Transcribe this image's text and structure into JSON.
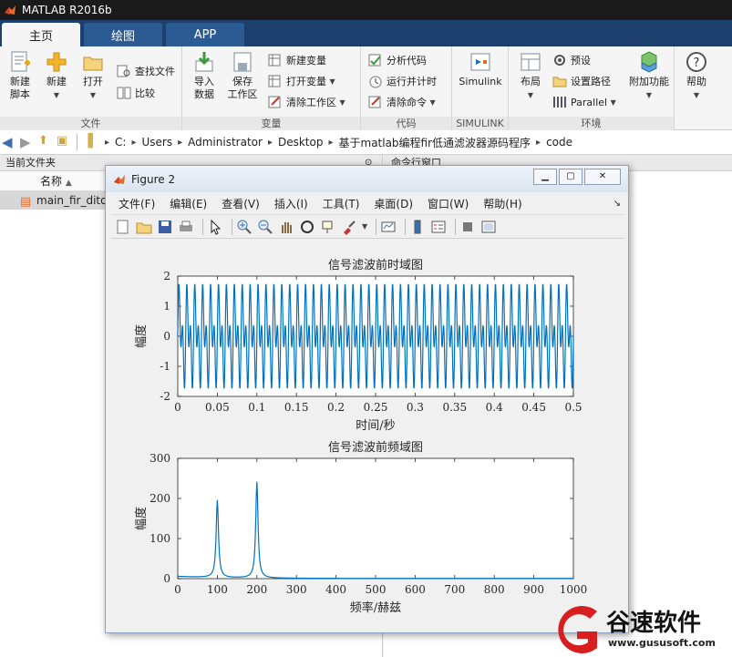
{
  "window": {
    "title": "MATLAB R2016b"
  },
  "tabs": [
    {
      "label": "主页"
    },
    {
      "label": "绘图"
    },
    {
      "label": "APP"
    }
  ],
  "ribbon": {
    "file": {
      "label": "文件",
      "new_script": "新建\n脚本",
      "new": "新建",
      "open": "打开",
      "find_files": "查找文件",
      "compare": "比较"
    },
    "variable": {
      "label": "变量",
      "import": "导入\n数据",
      "save_workspace": "保存\n工作区",
      "new_variable": "新建变量",
      "open_variable": "打开变量",
      "clear_workspace": "清除工作区"
    },
    "code": {
      "label": "代码",
      "analyze": "分析代码",
      "run_time": "运行并计时",
      "clear_commands": "清除命令"
    },
    "simulink": {
      "label": "SIMULINK",
      "button": "Simulink"
    },
    "environment": {
      "label": "环境",
      "layout": "布局",
      "preferences": "预设",
      "set_path": "设置路径",
      "parallel": "Parallel",
      "addons": "附加功能"
    },
    "help": {
      "label": "帮助"
    }
  },
  "address": {
    "segments": [
      "C:",
      "Users",
      "Administrator",
      "Desktop",
      "基于matlab编程fir低通滤波器源码程序",
      "code"
    ]
  },
  "current_folder": {
    "title": "当前文件夹",
    "column_name": "名称",
    "files": [
      "main_fir_dito"
    ]
  },
  "command_window": {
    "title": "命令行窗口"
  },
  "figure": {
    "title": "Figure 2",
    "menu": [
      "文件(F)",
      "编辑(E)",
      "查看(V)",
      "插入(I)",
      "工具(T)",
      "桌面(D)",
      "窗口(W)",
      "帮助(H)"
    ]
  },
  "chart_data": [
    {
      "type": "line",
      "title": "信号滤波前时域图",
      "xlabel": "时间/秒",
      "ylabel": "幅度",
      "xlim": [
        0,
        0.5
      ],
      "ylim": [
        -2,
        2
      ],
      "xticks": [
        "0",
        "0.05",
        "0.1",
        "0.15",
        "0.2",
        "0.25",
        "0.3",
        "0.35",
        "0.4",
        "0.45",
        "0.5"
      ],
      "yticks": [
        "-2",
        "-1",
        "0",
        "1",
        "2"
      ],
      "signal": "sin(2*pi*100*t) + sin(2*pi*200*t) (peak ≈ ±1.76)",
      "components_hz": [
        100,
        200
      ],
      "amplitude_peak": 1.76,
      "color": "#0072bd",
      "grid": false
    },
    {
      "type": "line",
      "title": "信号滤波前频域图",
      "xlabel": "频率/赫兹",
      "ylabel": "幅度",
      "xlim": [
        0,
        1000
      ],
      "ylim": [
        0,
        300
      ],
      "xticks": [
        "0",
        "100",
        "200",
        "300",
        "400",
        "500",
        "600",
        "700",
        "800",
        "900",
        "1000"
      ],
      "yticks": [
        "0",
        "100",
        "200",
        "300"
      ],
      "peaks": [
        {
          "x": 100,
          "y": 193
        },
        {
          "x": 200,
          "y": 240
        }
      ],
      "baseline": 5,
      "color": "#0072bd",
      "grid": false
    }
  ],
  "watermark": {
    "text": "谷速软件",
    "url": "www.gususoft.com"
  }
}
